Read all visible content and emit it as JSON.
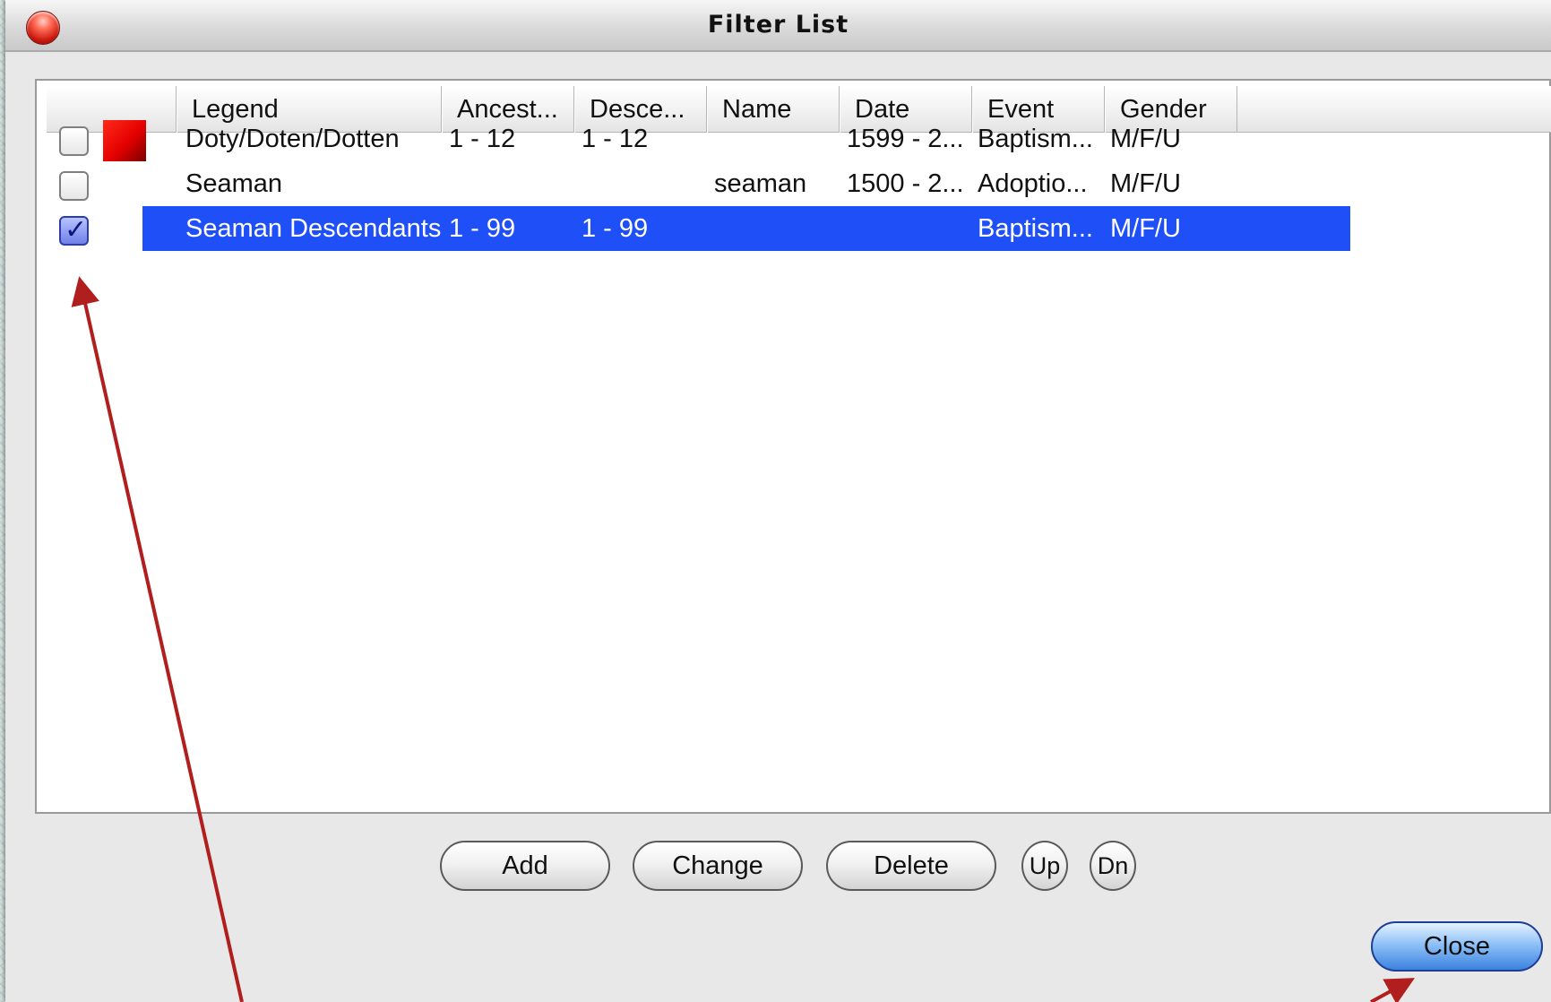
{
  "window": {
    "title": "Filter List"
  },
  "columns": [
    "",
    "Legend",
    "Ancest...",
    "Desce...",
    "Name",
    "Date",
    "Event",
    "Gender"
  ],
  "rows": [
    {
      "checked": false,
      "has_swatch": true,
      "swatch_color": "#e40000",
      "legend": "Doty/Doten/Dotten",
      "ancestors": "1 - 12",
      "descendants": "1 - 12",
      "name": "",
      "date": "1599 - 2...",
      "event": "Baptism...",
      "gender": "M/F/U",
      "selected": false
    },
    {
      "checked": false,
      "has_swatch": false,
      "legend": "Seaman",
      "ancestors": "",
      "descendants": "",
      "name": "seaman",
      "date": "1500 - 2...",
      "event": "Adoptio...",
      "gender": "M/F/U",
      "selected": false
    },
    {
      "checked": true,
      "has_swatch": false,
      "legend": "Seaman Descendants",
      "ancestors": "1 - 99",
      "descendants": "1 - 99",
      "name": "",
      "date": "",
      "event": "Baptism...",
      "gender": "M/F/U",
      "selected": true
    }
  ],
  "buttons": {
    "add": "Add",
    "change": "Change",
    "delete": "Delete",
    "up": "Up",
    "down": "Dn",
    "close": "Close"
  },
  "colors": {
    "selection": "#1f4ff6",
    "annotation_arrow": "#b01e1e"
  }
}
